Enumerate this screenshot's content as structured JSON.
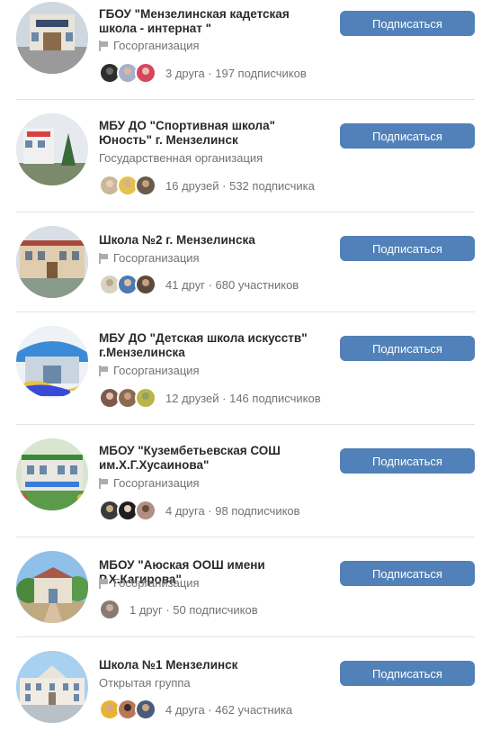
{
  "subscribe_label": "Подписаться",
  "accent_color": "#5181b8",
  "communities": [
    {
      "title": "ГБОУ \"Мензелинская кадетская школа - интернат \"",
      "type": "Госорганизация",
      "has_flag_icon": true,
      "friends": "3 друга · 197 подписчиков",
      "faces": [
        "#2d2d2d",
        "#a7b0c8",
        "#d6455a"
      ]
    },
    {
      "title": "МБУ ДО \"Спортивная школа\" Юность\" г. Мензелинск",
      "type": "Государственная организация",
      "has_flag_icon": false,
      "friends": "16 друзей · 532 подписчика",
      "faces": [
        "#c9b99a",
        "#e2c24a",
        "#6a5a4a"
      ]
    },
    {
      "title": "Школа №2 г. Мензелинска",
      "type": "Госорганизация",
      "has_flag_icon": true,
      "friends": "41 друг · 680 участников",
      "faces": [
        "#d8d2c0",
        "#4e78b0",
        "#5a4a3e"
      ]
    },
    {
      "title": "МБУ ДО \"Детская школа искусств\" г.Мензелинска",
      "type": "Госорганизация",
      "has_flag_icon": true,
      "friends": "12 друзей · 146 подписчиков",
      "faces": [
        "#7a5a4a",
        "#8a6a50",
        "#b8b64a"
      ]
    },
    {
      "title": "МБОУ \"Кузембетьевская СОШ им.Х.Г.Хусаинова\"",
      "type": "Госорганизация",
      "has_flag_icon": true,
      "friends": "4 друга · 98 подписчиков",
      "faces": [
        "#3a3a3a",
        "#1e1e1e",
        "#b09080"
      ]
    },
    {
      "title": "МБОУ \"Аюская ООШ имени Р.Х.Кагирова\"",
      "type": "Госорганизация",
      "has_flag_icon": true,
      "friends": "1 друг · 50 подписчиков",
      "faces": [
        "#8a7a70"
      ]
    },
    {
      "title": "Школа №1 Мензелинск",
      "type": "Открытая группа",
      "has_flag_icon": false,
      "friends": "4 друга · 462 участника",
      "faces": [
        "#e8b430",
        "#b87858",
        "#4a5a7a"
      ]
    }
  ]
}
